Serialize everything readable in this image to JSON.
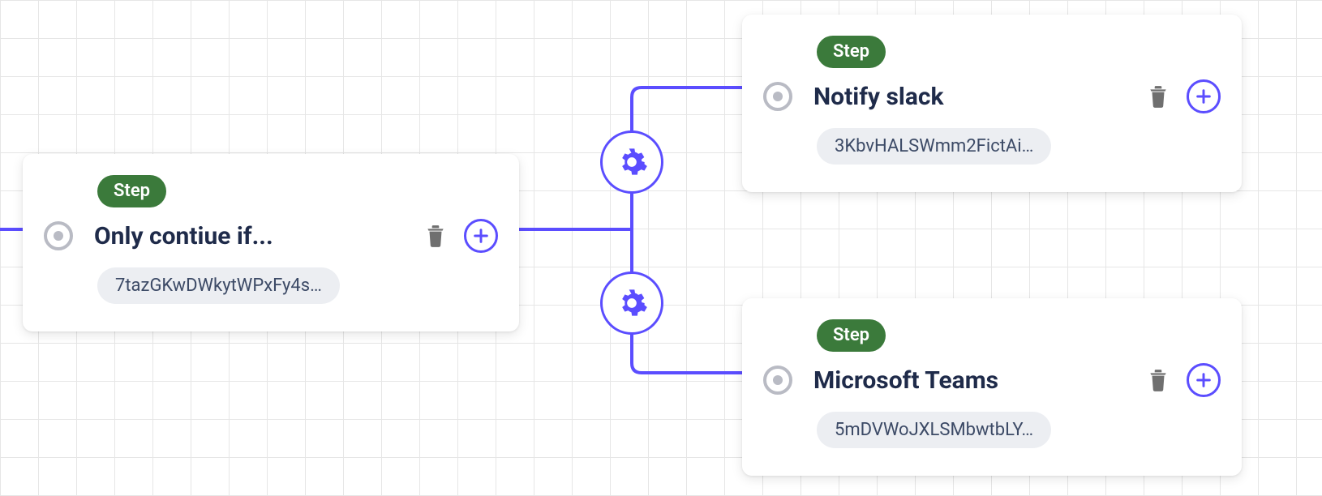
{
  "colors": {
    "connector": "#5b4dff",
    "badge_bg": "#3b7a3b",
    "title_text": "#1f2b4a",
    "chip_bg": "#eceef2",
    "trash": "#6f6f6f"
  },
  "badge_label": "Step",
  "nodes": {
    "condition": {
      "title": "Only contiue if...",
      "id_chip": "7tazGKwDWkytWPxFy4s…"
    },
    "slack": {
      "title": "Notify slack",
      "id_chip": "3KbvHALSWmm2FictAi…"
    },
    "teams": {
      "title": "Microsoft Teams",
      "id_chip": "5mDVWoJXLSMbwtbLY…"
    }
  }
}
